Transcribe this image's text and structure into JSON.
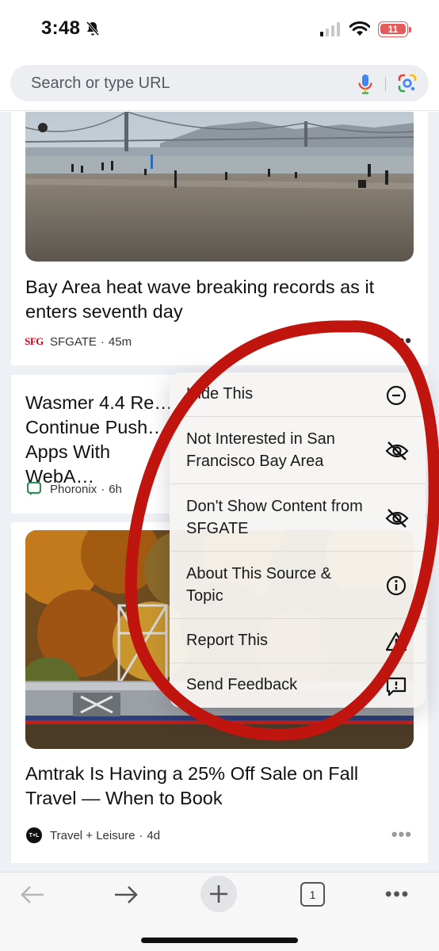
{
  "status_bar": {
    "time": "3:48",
    "battery": "11",
    "icons": [
      "bell-slash-icon",
      "cellular-signal-icon",
      "wifi-icon",
      "battery-charging-icon"
    ]
  },
  "omnibox": {
    "placeholder": "Search or type URL",
    "icons": [
      "microphone-icon",
      "google-lens-icon"
    ]
  },
  "feed": {
    "cards": [
      {
        "title": "Bay Area heat wave breaking records as it enters seventh day",
        "source_logo": "SFG",
        "source": "SFGATE",
        "age": "45m",
        "image": "beach-golden-gate-bridge-photo"
      },
      {
        "title": "Wasmer 4.4 Re… Continue Push… Apps With WebA…",
        "source": "Phoronix",
        "age": "6h"
      },
      {
        "title": "Amtrak Is Having a 25% Off Sale on Fall Travel — When to Book",
        "source_logo": "T+L",
        "source": "Travel + Leisure",
        "age": "4d",
        "image": "amtrak-train-autumn-trees-photo"
      }
    ],
    "separator": "·"
  },
  "context_menu": {
    "items": [
      {
        "label": "Hide This",
        "icon": "hide-icon"
      },
      {
        "label": "Not Interested in San Francisco Bay Area",
        "icon": "eye-slash-icon"
      },
      {
        "label": "Don't Show Content from SFGATE",
        "icon": "eye-slash-icon"
      },
      {
        "label": "About This Source & Topic",
        "icon": "info-icon"
      },
      {
        "label": "Report This",
        "icon": "warning-icon"
      },
      {
        "label": "Send Feedback",
        "icon": "feedback-icon"
      }
    ]
  },
  "toolbar": {
    "tab_count": "1",
    "icons": [
      "back-arrow-icon",
      "forward-arrow-icon",
      "new-tab-plus-icon",
      "tab-switcher-icon",
      "more-options-icon"
    ]
  },
  "colors": {
    "annotation_red": "#c0150f",
    "sfgate_red": "#d0021b",
    "phoronix_green": "#2e8b57"
  }
}
